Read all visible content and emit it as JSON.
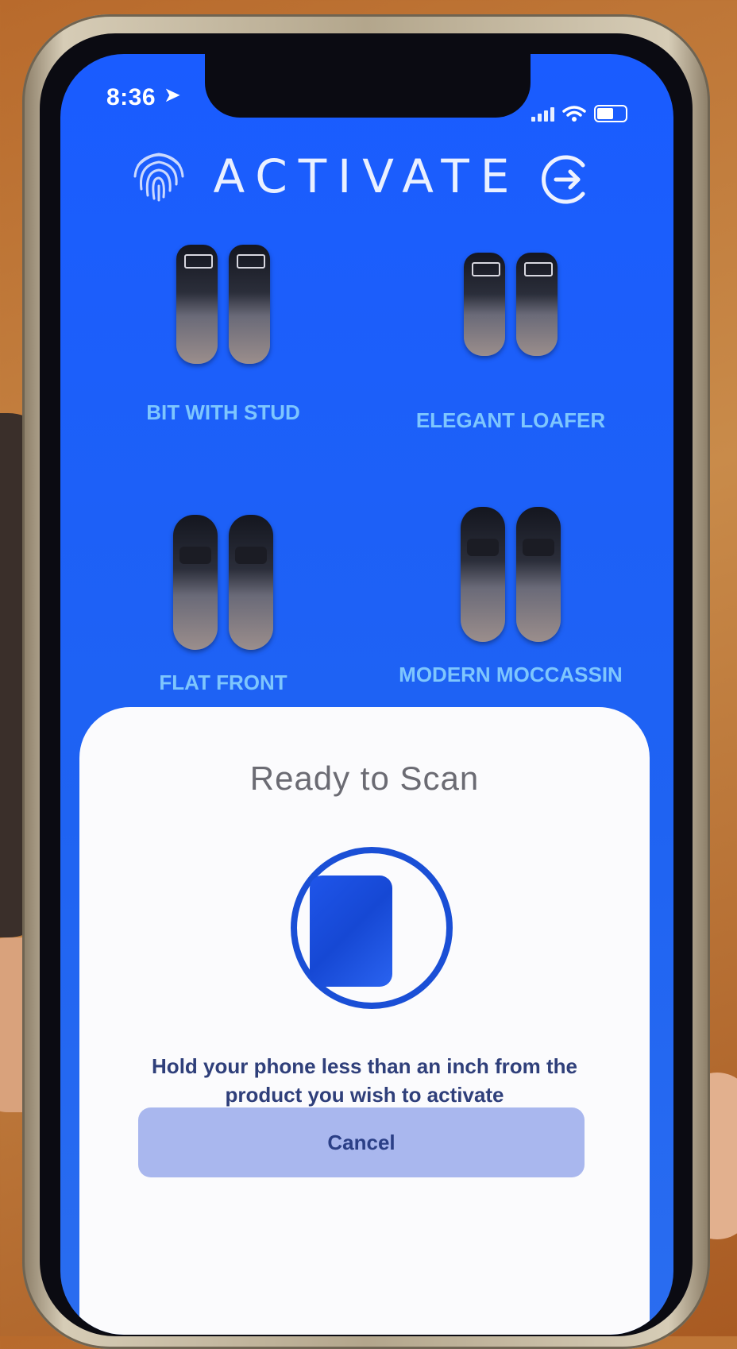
{
  "status_bar": {
    "time": "8:36",
    "location_glyph": "➤"
  },
  "header": {
    "title": "ACTIVATE",
    "left_icon": "fingerprint-icon",
    "right_icon": "exit-icon"
  },
  "products": [
    {
      "label": "BIT WITH STUD"
    },
    {
      "label": "ELEGANT LOAFER"
    },
    {
      "label": "FLAT FRONT"
    },
    {
      "label": "MODERN MOCCASSIN"
    }
  ],
  "scan_sheet": {
    "title": "Ready to Scan",
    "message": "Hold your phone less than an inch from the product you wish to activate",
    "cancel_label": "Cancel"
  },
  "colors": {
    "screen": "#1a5cff",
    "accent": "#1a4fd6",
    "label": "#8fd8ff",
    "sheet": "#fbfbfd"
  }
}
